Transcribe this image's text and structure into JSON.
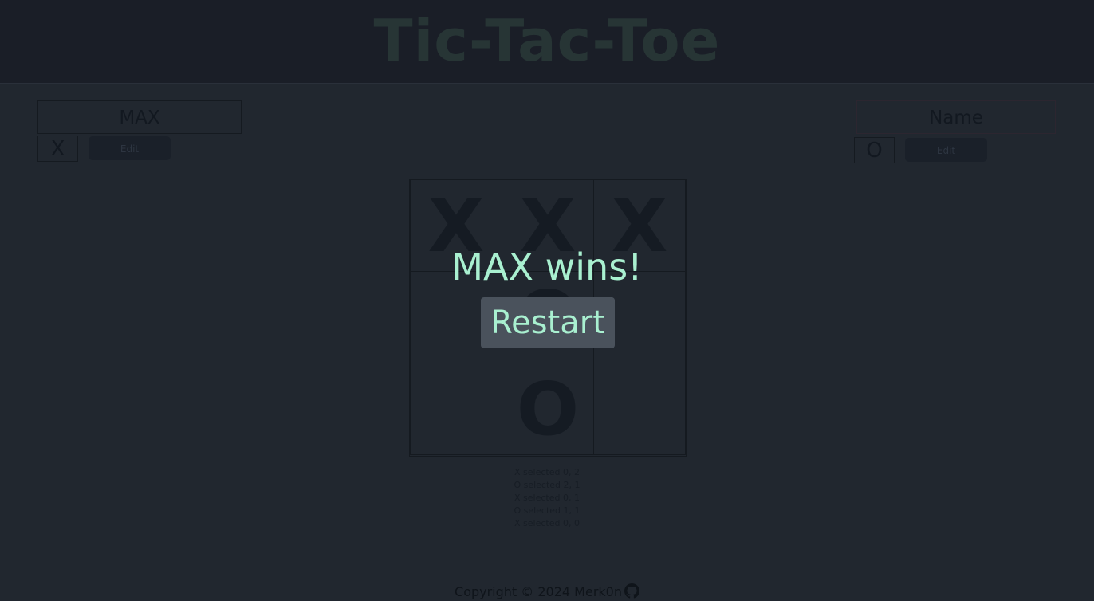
{
  "header": {
    "title": "Tic-Tac-Toe"
  },
  "players": [
    {
      "name": "MAX",
      "symbol": "X",
      "edit_label": "Edit"
    },
    {
      "name": "Name",
      "symbol": "O",
      "edit_label": "Edit"
    }
  ],
  "board": [
    [
      "X",
      "X",
      "X"
    ],
    [
      "",
      "O",
      ""
    ],
    [
      "",
      "O",
      ""
    ]
  ],
  "log": [
    "X selected 0, 2",
    "O selected 2, 1",
    "X selected 0, 1",
    "O selected 1, 1",
    "X selected 0, 0"
  ],
  "game_over": {
    "message": "MAX wins!",
    "restart_label": "Restart"
  },
  "footer": {
    "copyright": "Copyright © 2024 Merk0n",
    "icon": "github-icon"
  },
  "colors": {
    "accent_text": "#a9f0d0",
    "player_two_border": "#3a2630",
    "overlay_button": "#4a525c"
  }
}
